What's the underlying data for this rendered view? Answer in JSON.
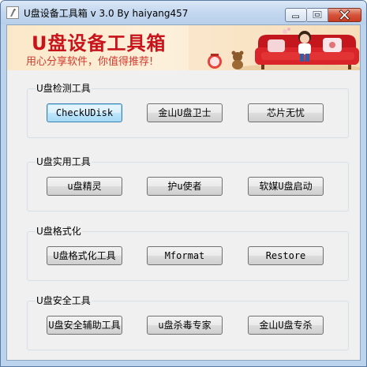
{
  "window": {
    "title": "U盘设备工具箱 v  3.0  By haiyang457"
  },
  "banner": {
    "title": "U盘设备工具箱",
    "slogan": "用心分享软件，你值得推荐!"
  },
  "colors": {
    "banner_title": "#c8131b",
    "title_bar": "#c3d7ef",
    "close_button": "#d6523a"
  },
  "groups": [
    {
      "title": "U盘检测工具",
      "buttons": [
        "CheckUDisk",
        "金山U盘卫士",
        "芯片无忧"
      ]
    },
    {
      "title": "U盘实用工具",
      "buttons": [
        "u盘精灵",
        "护u使者",
        "软媒U盘启动"
      ]
    },
    {
      "title": "U盘格式化",
      "buttons": [
        "U盘格式化工具",
        "Mformat",
        "Restore"
      ]
    },
    {
      "title": "U盘安全工具",
      "buttons": [
        "U盘安全辅助工具",
        "u盘杀毒专家",
        "金山U盘专杀"
      ]
    }
  ]
}
